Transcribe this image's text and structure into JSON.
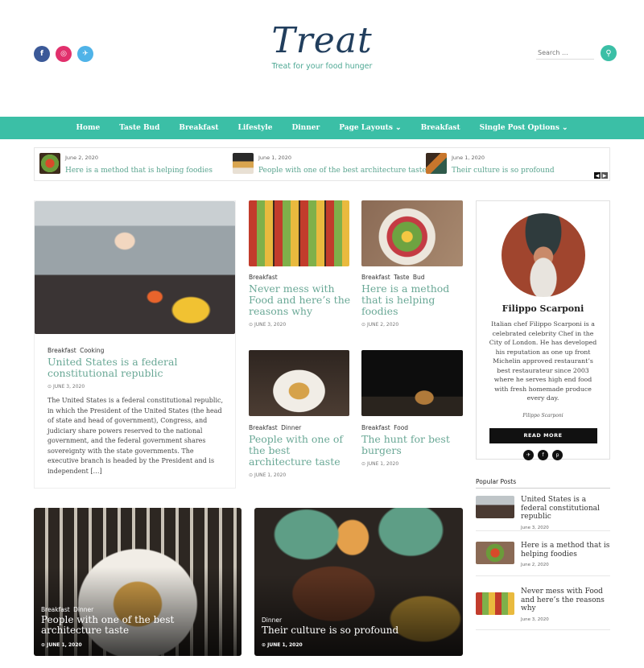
{
  "header": {
    "logo_title": "Treat",
    "tagline": "Treat for your food hunger",
    "search_placeholder": "Search ...",
    "search_icon": "search-icon",
    "social": [
      "facebook-icon",
      "instagram-icon",
      "twitter-icon"
    ]
  },
  "nav": {
    "items": [
      "Home",
      "Taste Bud",
      "Breakfast",
      "Lifestyle",
      "Dinner",
      "Page Layouts ⌄",
      "Breakfast",
      "Single Post Options ⌄"
    ]
  },
  "ticker": [
    {
      "date": "June 2, 2020",
      "title": "Here is a method that is helping foodies"
    },
    {
      "date": "June 1, 2020",
      "title": "People with one of the best architecture taste"
    },
    {
      "date": "June 1, 2020",
      "title": "Their culture is so profound"
    }
  ],
  "featured": {
    "cats": "Breakfast Cooking",
    "title": "United States is a federal constitutional republic",
    "date": "June 3, 2020",
    "excerpt": "The United States is a federal constitutional republic, in which the President of the United States (the head of state and head of government), Congress, and judiciary share powers reserved to the national government, and the federal government shares sovereignty with the state governments. The executive branch is headed by the President and is independent […]"
  },
  "grid": [
    {
      "cats": "Breakfast",
      "title": "Never mess with Food and here’s the reasons why",
      "date": "June 3, 2020"
    },
    {
      "cats": "Breakfast Taste Bud",
      "title": "Here is a method that is helping foodies",
      "date": "June 2, 2020"
    },
    {
      "cats": "Breakfast Dinner",
      "title": "People with one of the best architecture taste",
      "date": "June 1, 2020"
    },
    {
      "cats": "Breakfast Food",
      "title": "The hunt for best burgers",
      "date": "June 1, 2020"
    }
  ],
  "overlay": [
    {
      "cats": "Breakfast Dinner",
      "title": "People with one of the best architecture taste",
      "date": "June 1, 2020"
    },
    {
      "cats": "Dinner",
      "title": "Their culture is so profound",
      "date": "June 1, 2020"
    }
  ],
  "author": {
    "name": "Filippo Scarponi",
    "bio": "Italian chef Filippo Scarponi is a celebrated celebrity Chef in the City of London. He has developed his reputation as one up front Michelin approved restaurant’s best restaurateur since 2003 where he serves high end food with fresh homemade produce every day.",
    "signature": "Filippo Scarponi",
    "read_more": "READ MORE"
  },
  "popular": {
    "heading": "Popular Posts",
    "items": [
      {
        "title": "United States is a federal constitutional republic",
        "date": "June 3, 2020"
      },
      {
        "title": "Here is a method that is helping foodies",
        "date": "June 2, 2020"
      },
      {
        "title": "Never mess with Food and here’s the reasons why",
        "date": "June 3, 2020"
      }
    ]
  },
  "colors": {
    "accent": "#3bbfa6",
    "title_green": "#6aa896",
    "logo_blue": "#213e5d"
  }
}
